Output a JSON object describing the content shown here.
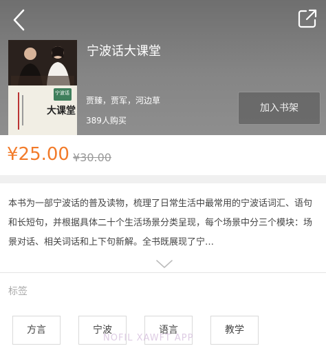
{
  "book": {
    "title": "宁波话大课堂",
    "authors": "贾臻，贾军，河边草",
    "buyers": "389人购买",
    "add_to_shelf_label": "加入书架",
    "price": "¥25.00",
    "original_price": "¥30.00",
    "description": "本书为一部宁波话的普及读物，梳理了日常生活中最常用的宁波话词汇、语句和长短句，并根据具体二十个生活场景分类呈现，每个场景中分三个模块：场景对话、相关词话和上下句新解。全书既展现了宁…"
  },
  "cover": {
    "big_label": "大课堂",
    "side_label": "宁波话"
  },
  "tags": {
    "label": "标签",
    "items": [
      "方言",
      "宁波",
      "语言",
      "教学"
    ]
  },
  "watermark": "NOFIL XAWFT APP",
  "colors": {
    "accent": "#f27b2a",
    "header_bg": "#7a7a7a"
  },
  "icons": {
    "back": "back-chevron-icon",
    "share": "share-icon",
    "expand": "chevron-down-icon"
  }
}
